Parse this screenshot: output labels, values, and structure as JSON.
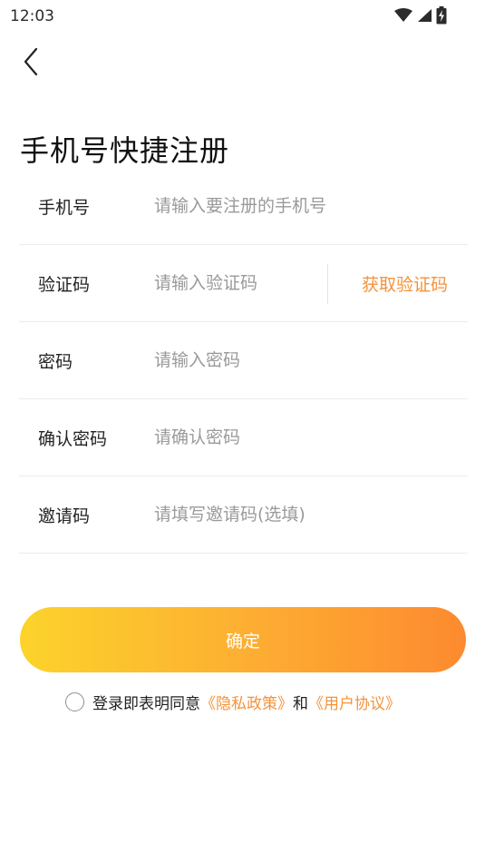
{
  "status_bar": {
    "time": "12:03",
    "icons": [
      "wifi-icon",
      "signal-icon",
      "battery-charging-icon"
    ]
  },
  "header": {
    "back_icon": "chevron-left-icon",
    "title": "手机号快捷注册"
  },
  "form": {
    "phone": {
      "label": "手机号",
      "placeholder": "请输入要注册的手机号",
      "value": ""
    },
    "code": {
      "label": "验证码",
      "placeholder": "请输入验证码",
      "value": "",
      "get_code_label": "获取验证码"
    },
    "password": {
      "label": "密码",
      "placeholder": "请输入密码",
      "value": ""
    },
    "confirm_password": {
      "label": "确认密码",
      "placeholder": "请确认密码",
      "value": ""
    },
    "invite": {
      "label": "邀请码",
      "placeholder": "请填写邀请码(选填)",
      "value": ""
    }
  },
  "actions": {
    "confirm_label": "确定"
  },
  "agreement": {
    "checked": false,
    "prefix": "登录即表明同意",
    "privacy_link": "《隐私政策》",
    "conjunction": "和",
    "terms_link": "《用户协议》"
  },
  "colors": {
    "accent": "#f5923a",
    "button_gradient_start": "#fcd32b",
    "button_gradient_end": "#fd8a2f",
    "placeholder": "#9a9a9a",
    "divider": "#ececec"
  }
}
